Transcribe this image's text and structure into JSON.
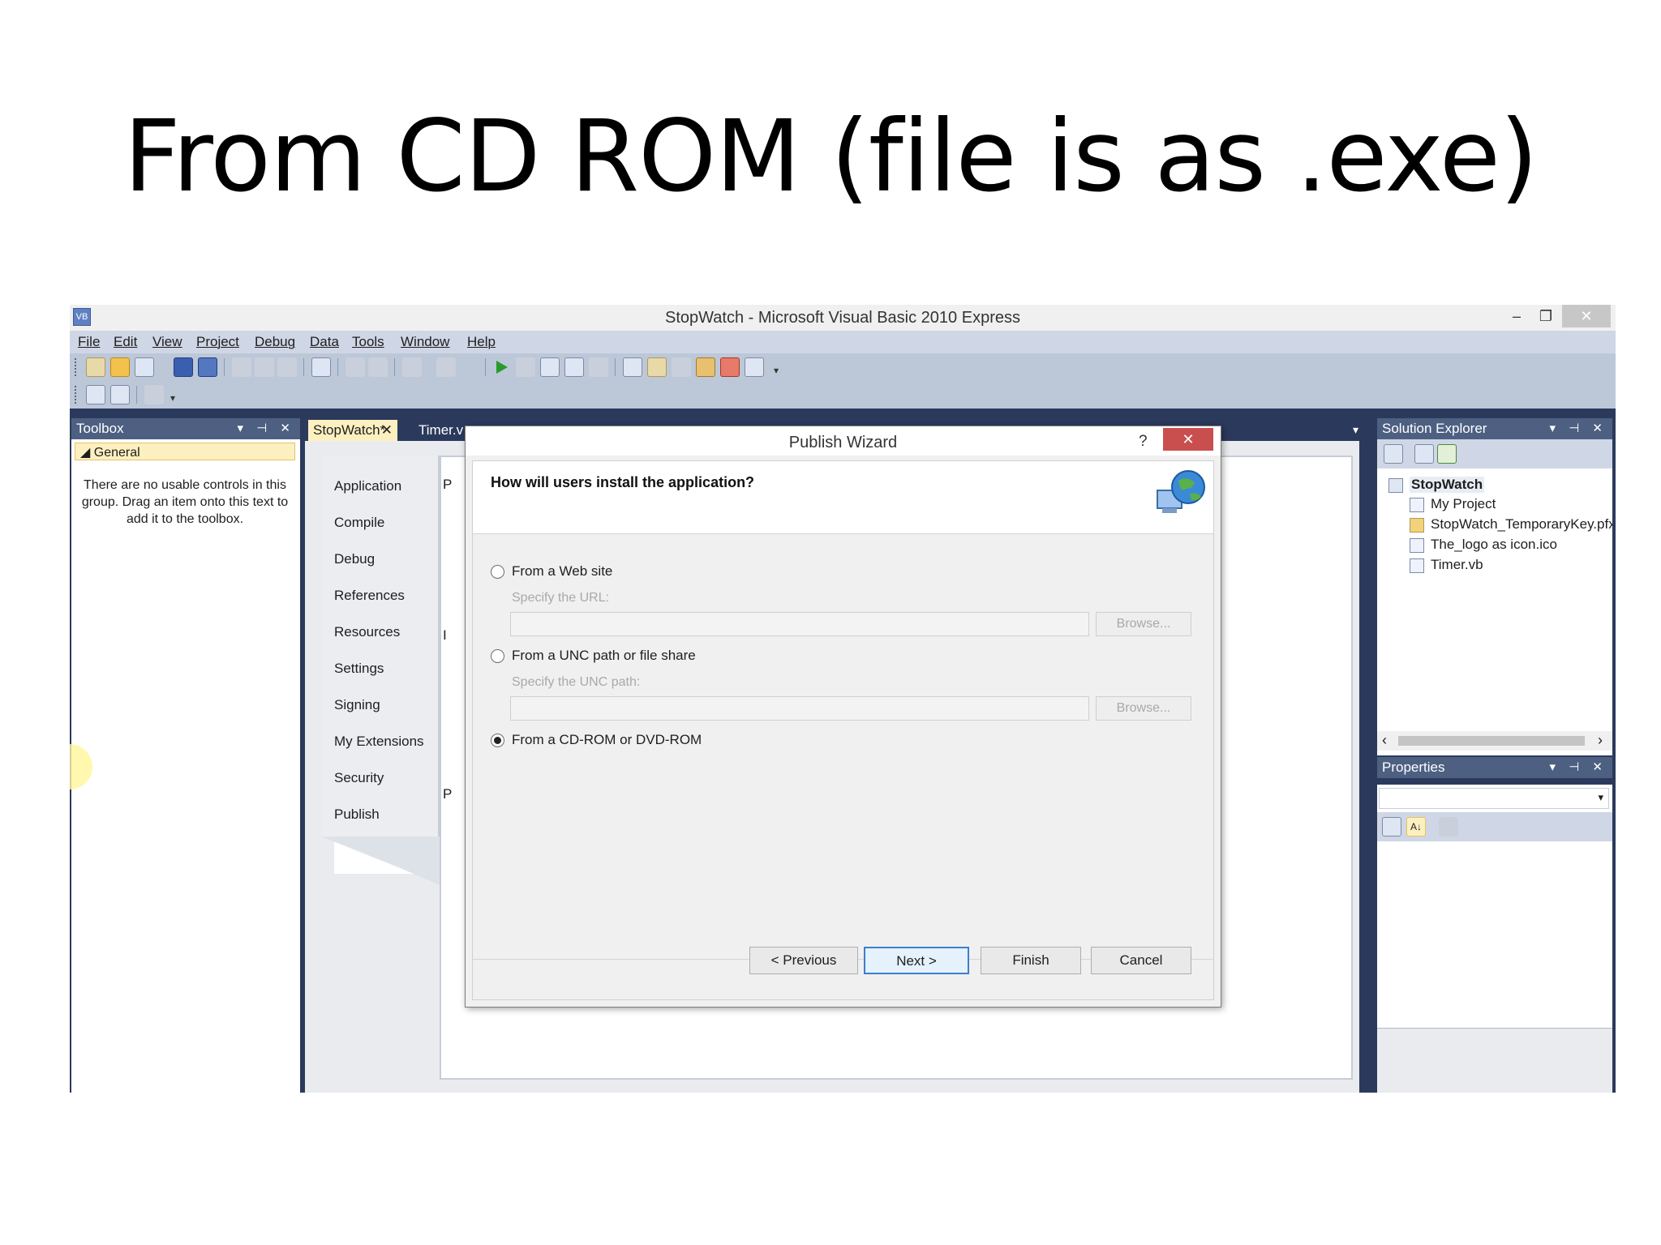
{
  "slide": {
    "title": "From CD ROM (file is as .exe)"
  },
  "window": {
    "title": "StopWatch - Microsoft Visual Basic 2010 Express",
    "minimize": "–",
    "restore": "❐",
    "close": "✕"
  },
  "menu": [
    "File",
    "Edit",
    "View",
    "Project",
    "Debug",
    "Data",
    "Tools",
    "Window",
    "Help"
  ],
  "toolbox": {
    "title": "Toolbox",
    "controls": "▾ ⊣ ✕",
    "group": "◢ General",
    "message": "There are no usable controls in this group. Drag an item onto this text to add it to the toolbox."
  },
  "tabs": {
    "active": "StopWatch*",
    "active_close": "✕",
    "inactive": "Timer.v",
    "overflow": "▾"
  },
  "property_tabs": [
    "Application",
    "Compile",
    "Debug",
    "References",
    "Resources",
    "Settings",
    "Signing",
    "My Extensions",
    "Security",
    "Publish"
  ],
  "page_letters": [
    "P",
    "I",
    "P"
  ],
  "solution_explorer": {
    "title": "Solution Explorer",
    "controls": "▾ ⊣ ✕",
    "root": "StopWatch",
    "items": [
      "My Project",
      "StopWatch_TemporaryKey.pfx",
      "The_logo as icon.ico",
      "Timer.vb"
    ],
    "scroll_left": "‹",
    "scroll_right": "›"
  },
  "properties": {
    "title": "Properties",
    "controls": "▾ ⊣ ✕",
    "combo_arrow": "▾",
    "sort_label": "A↓"
  },
  "wizard": {
    "title": "Publish Wizard",
    "help": "?",
    "close": "✕",
    "question": "How will users install the application?",
    "options": [
      {
        "label": "From a Web site",
        "hint": "Specify the URL:",
        "browse": "Browse...",
        "checked": false
      },
      {
        "label": "From a UNC path or file share",
        "hint": "Specify the UNC path:",
        "browse": "Browse...",
        "checked": false
      },
      {
        "label": "From a CD-ROM or DVD-ROM",
        "checked": true
      }
    ],
    "buttons": {
      "previous": "< Previous",
      "next": "Next >",
      "finish": "Finish",
      "cancel": "Cancel"
    }
  },
  "colors": {
    "ide_bg": "#2b3a5c",
    "panel_header": "#4d6082",
    "tab_active": "#fdf0c0",
    "close_red": "#c94f4f",
    "primary_border": "#3c7fcf"
  }
}
